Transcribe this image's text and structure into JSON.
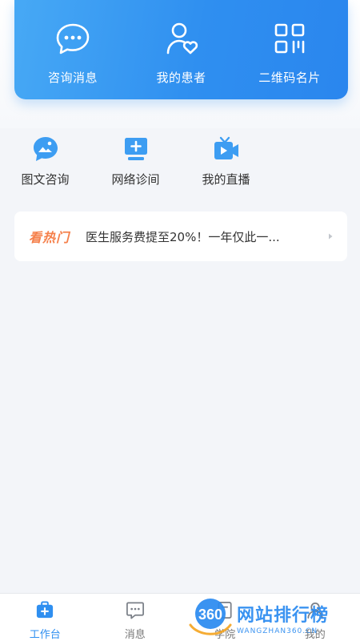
{
  "header": {
    "items": [
      {
        "label": "咨询消息",
        "icon": "chat-bubble-icon"
      },
      {
        "label": "我的患者",
        "icon": "patient-heart-icon"
      },
      {
        "label": "二维码名片",
        "icon": "qr-code-icon"
      }
    ]
  },
  "quick_actions": [
    {
      "label": "图文咨询",
      "icon": "image-chat-icon"
    },
    {
      "label": "网络诊间",
      "icon": "monitor-plus-icon"
    },
    {
      "label": "我的直播",
      "icon": "live-video-icon"
    }
  ],
  "hot": {
    "tag": "看热门",
    "text": "医生服务费提至20%！一年仅此一..."
  },
  "tabbar": {
    "items": [
      {
        "label": "工作台",
        "icon": "medical-kit-icon",
        "active": true
      },
      {
        "label": "消息",
        "icon": "message-icon",
        "active": false
      },
      {
        "label": "学院",
        "icon": "book-icon",
        "active": false
      },
      {
        "label": "我的",
        "icon": "user-icon",
        "active": false
      }
    ]
  },
  "watermark": {
    "badge": "360",
    "title": "网站排行榜",
    "subtitle": "WANGZHAN360.CN"
  },
  "colors": {
    "primary": "#2f8ff0",
    "hot_tag": "#f5804b",
    "background": "#f3f5f9"
  }
}
